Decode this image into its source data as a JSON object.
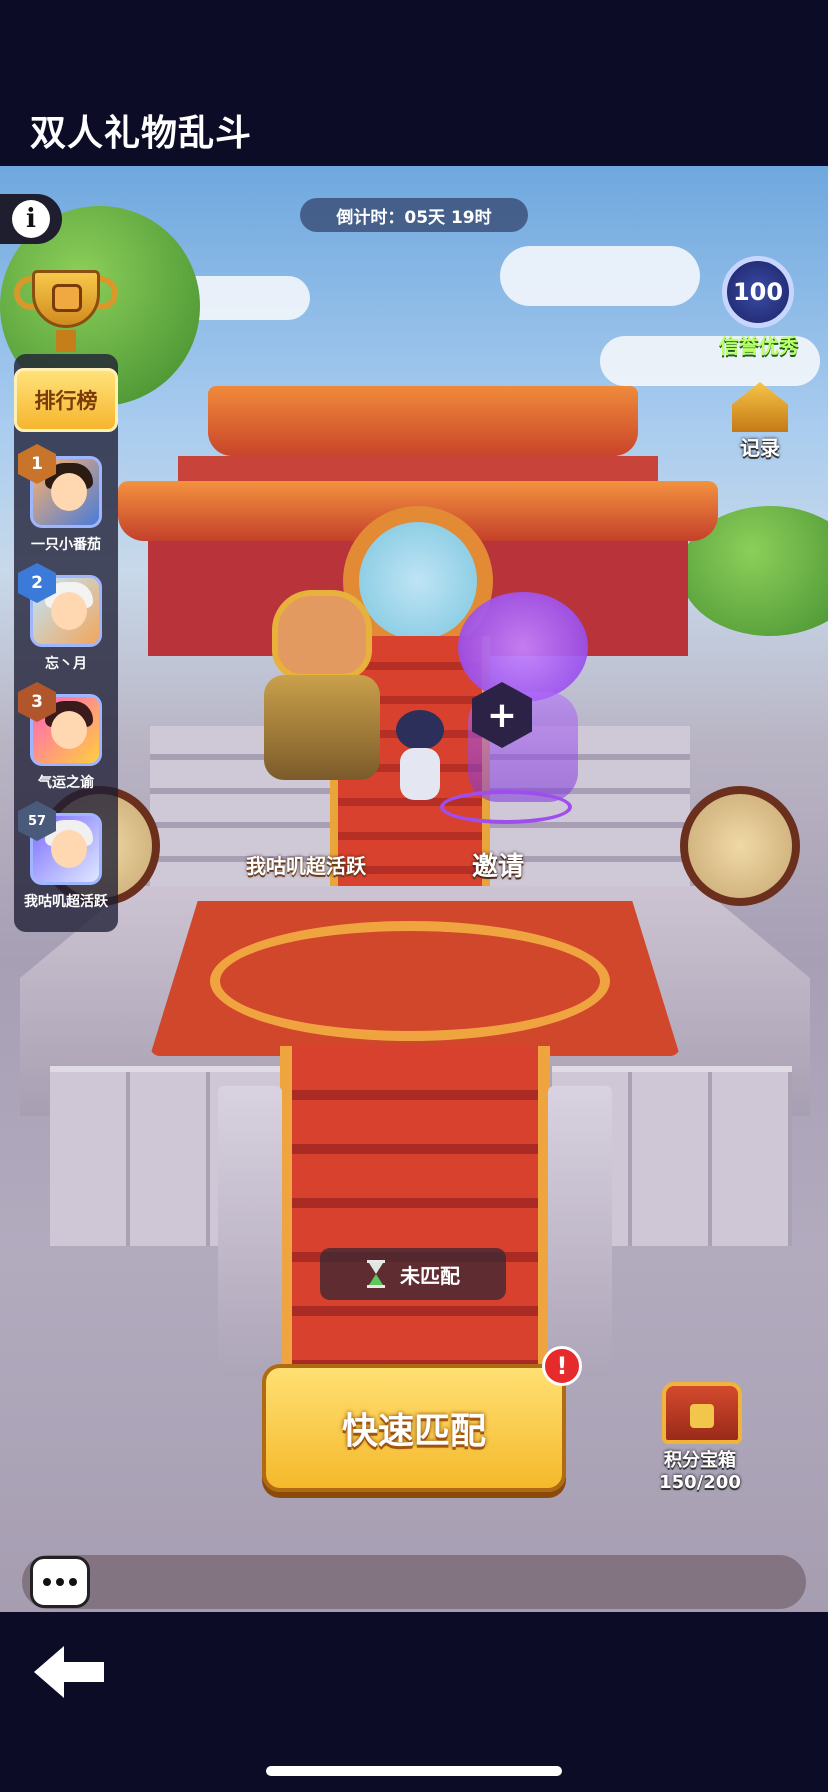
{
  "header": {
    "title": "双人礼物乱斗"
  },
  "event": {
    "countdown": "倒计时：05天 19时"
  },
  "leaderboard": {
    "tab_label": "排行榜",
    "entries": [
      {
        "rank": "1",
        "name": "一只小番茄",
        "badge_color": "#c8742a"
      },
      {
        "rank": "2",
        "name": "忘丶月",
        "badge_color": "#3b7ad8"
      },
      {
        "rank": "3",
        "name": "气运之谕",
        "badge_color": "#b0562a"
      },
      {
        "rank": "57",
        "name": "我咕叽超活跃",
        "badge_color": "#4a5a7a"
      }
    ]
  },
  "credit": {
    "score": "100",
    "label": "信誉优秀"
  },
  "record": {
    "label": "记录"
  },
  "team": {
    "player_name": "我咕叽超活跃",
    "invite_label": "邀请",
    "invite_symbol": "+"
  },
  "match": {
    "status": "未匹配",
    "quick_match_label": "快速匹配",
    "alert_symbol": "!"
  },
  "chest": {
    "label": "积分宝箱",
    "progress": "150/200"
  },
  "colors": {
    "accent": "#f5b92b",
    "background": "#0c0c26",
    "alert": "#e52b2b"
  },
  "icons": {
    "info": "info-icon",
    "trophy": "trophy-icon",
    "chat": "chat-icon",
    "back": "back-arrow-icon",
    "hourglass": "hourglass-icon",
    "chest": "treasure-chest-icon",
    "credit": "credit-badge-icon",
    "record": "record-icon"
  }
}
